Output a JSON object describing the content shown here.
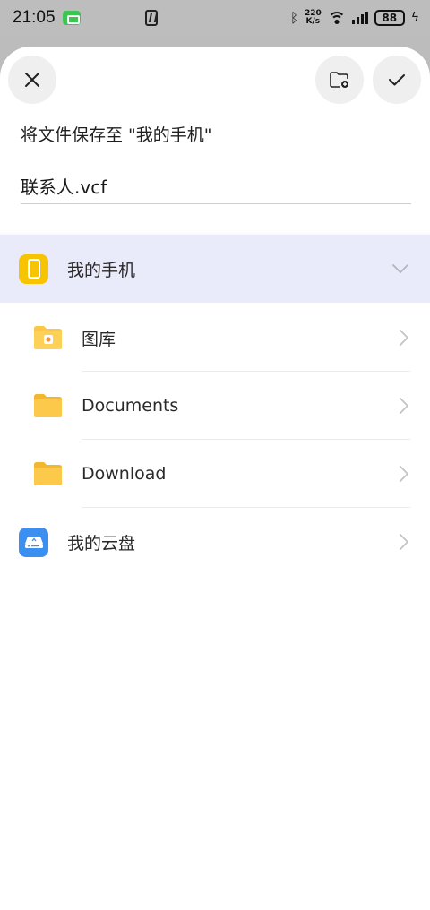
{
  "status_bar": {
    "time": "21:05",
    "speed_value": "220",
    "speed_unit": "K/s",
    "battery": "88"
  },
  "toolbar": {
    "close_icon": "close-icon",
    "new_folder_icon": "new-folder-icon",
    "confirm_icon": "check-icon"
  },
  "dialog": {
    "title": "将文件保存至 \"我的手机\"",
    "filename": "联系人.vcf"
  },
  "locations": [
    {
      "label": "我的手机",
      "icon": "phone-storage-icon",
      "expanded": true,
      "selected": true
    },
    {
      "label": "图库",
      "icon": "gallery-folder-icon",
      "child": true
    },
    {
      "label": "Documents",
      "icon": "folder-icon",
      "child": true
    },
    {
      "label": "Download",
      "icon": "folder-icon",
      "child": true
    },
    {
      "label": "我的云盘",
      "icon": "cloud-drive-icon"
    }
  ],
  "colors": {
    "accent_selected_bg": "#e9ebfb",
    "folder": "#fbc744",
    "phone_icon": "#f6c400",
    "cloud_icon": "#3a8ff0"
  }
}
